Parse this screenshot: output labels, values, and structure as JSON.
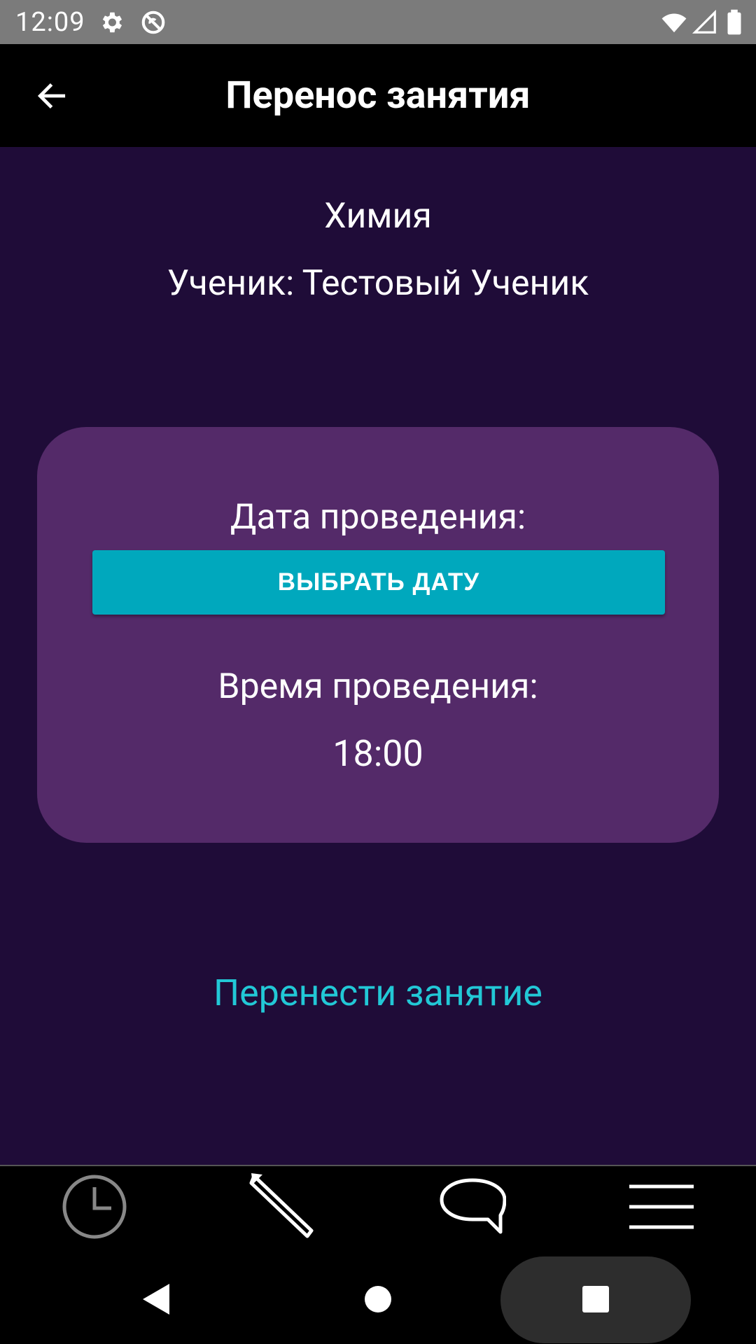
{
  "status_bar": {
    "time": "12:09"
  },
  "app_bar": {
    "title": "Перенос занятия"
  },
  "lesson": {
    "subject": "Химия",
    "student_line": "Ученик: Тестовый Ученик"
  },
  "card": {
    "date_label": "Дата проведения:",
    "date_button": "ВЫБРАТЬ ДАТУ",
    "time_label": "Время проведения:",
    "time_value": "18:00"
  },
  "action": {
    "reschedule_label": "Перенести занятие"
  },
  "bottom_nav": {
    "items": [
      {
        "icon": "clock-icon"
      },
      {
        "icon": "pencil-icon"
      },
      {
        "icon": "chat-icon"
      },
      {
        "icon": "menu-icon"
      }
    ]
  },
  "colors": {
    "background": "#1f0c38",
    "card": "#542a69",
    "accent": "#00a8bd",
    "link": "#22c8d6"
  }
}
